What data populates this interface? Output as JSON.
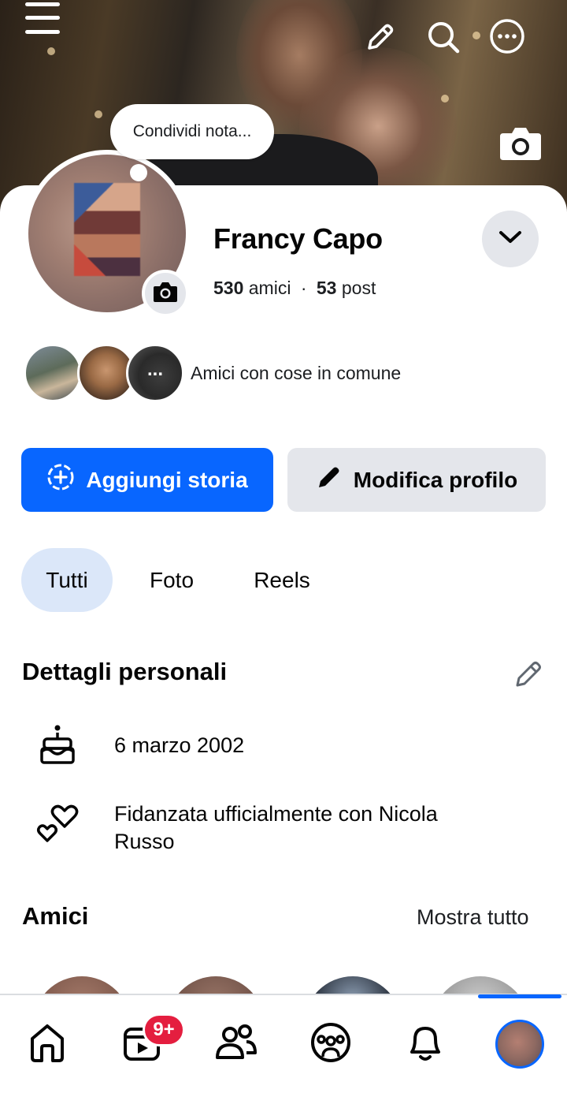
{
  "cover": {
    "menu_icon": "hamburger-icon",
    "edit_icon": "pencil-icon",
    "search_icon": "search-icon",
    "more_icon": "more-horizontal-icon",
    "camera_icon": "camera-icon"
  },
  "profile": {
    "note_placeholder": "Condividi nota...",
    "name": "Francy Capo",
    "friends_count": "530",
    "friends_label": "amici",
    "separator": "·",
    "posts_count": "53",
    "posts_label": "post",
    "mutual_more": "...",
    "mutual_text": "Amici con cose in comune"
  },
  "actions": {
    "add_story": "Aggiungi storia",
    "edit_profile": "Modifica profilo"
  },
  "tabs": [
    {
      "label": "Tutti",
      "active": true
    },
    {
      "label": "Foto",
      "active": false
    },
    {
      "label": "Reels",
      "active": false
    }
  ],
  "details": {
    "title": "Dettagli personali",
    "birthday": "6 marzo 2002",
    "relationship_line1": "Fidanzata ufficialmente con Nicola",
    "relationship_line2": "Russo"
  },
  "friends": {
    "title": "Amici",
    "see_all": "Mostra tutto"
  },
  "nav": {
    "items": [
      "home-icon",
      "video-icon",
      "friends-icon",
      "groups-icon",
      "bell-icon",
      "profile-avatar"
    ],
    "video_badge": "9+",
    "accent": "#0866ff",
    "badge_color": "#e41e3f"
  }
}
